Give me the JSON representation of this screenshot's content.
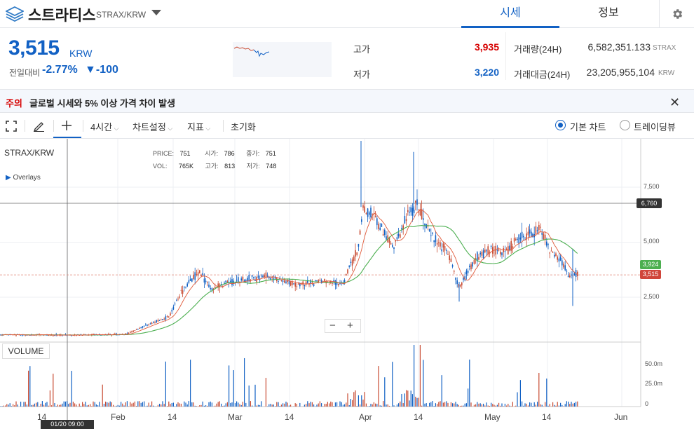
{
  "header": {
    "coin_name": "스트라티스",
    "pair": "STRAX/KRW",
    "tabs": [
      "시세",
      "정보"
    ]
  },
  "summary": {
    "price": "3,515",
    "unit": "KRW",
    "change_label": "전일대비",
    "change_rate": "-2.77%",
    "change_amount": "▼-100",
    "high_label": "고가",
    "high": "3,935",
    "low_label": "저가",
    "low": "3,220",
    "volume_label": "거래량(24H)",
    "volume": "6,582,351.133",
    "volume_unit": "STRAX",
    "amount_label": "거래대금(24H)",
    "amount": "23,205,955,104",
    "amount_unit": "KRW"
  },
  "notice": {
    "tag": "주의",
    "text": "글로벌 시세와 5% 이상 가격 차이 발생",
    "close": "✕"
  },
  "toolbar": {
    "interval": "4시간",
    "chart_settings": "차트설정",
    "indicators": "지표",
    "reset": "초기화",
    "basic_chart": "기본 차트",
    "tradingview": "트레이딩뷰"
  },
  "chart": {
    "symbol": "STRAX/KRW",
    "overlays": "Overlays",
    "ohlc": {
      "price_label": "PRICE:",
      "price": "751",
      "open_label": "시가:",
      "open": "786",
      "close_label": "종가:",
      "close": "751",
      "vol_label": "VOL:",
      "vol": "765K",
      "high_label": "고가:",
      "high": "813",
      "low_label": "저가:",
      "low": "748"
    },
    "y_ticks": [
      "7,500",
      "5,000",
      "2,500"
    ],
    "y_tick_values": [
      7500,
      5000,
      2500
    ],
    "crosshair_price": "6,760",
    "ma_price": "3,924",
    "current_price": "3,515",
    "volume_btn": "VOLUME",
    "vol_ticks": [
      "50.0m",
      "25.0m",
      "0"
    ],
    "x_ticks": [
      "14",
      "Feb",
      "14",
      "Mar",
      "14",
      "Apr",
      "14",
      "May",
      "14",
      "Jun"
    ],
    "crosshair_date": "01/20 09:00",
    "zoom_minus": "−",
    "zoom_plus": "+"
  },
  "colors": {
    "up": "#c84a31",
    "down": "#1261c4",
    "ma": "#4caf50",
    "accent": "#1261c4"
  }
}
